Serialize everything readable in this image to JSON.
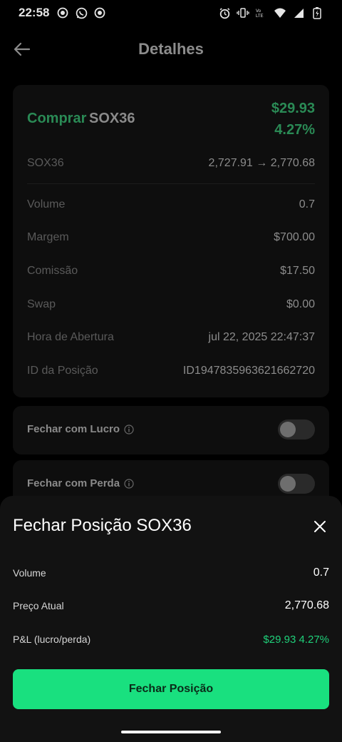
{
  "status_bar": {
    "time": "22:58",
    "left_icons": [
      "record-icon",
      "whatsapp-icon",
      "record-icon"
    ],
    "right_icons": [
      "alarm-icon",
      "vibrate-icon",
      "volte-icon",
      "wifi-icon",
      "signal-icon",
      "battery-icon"
    ]
  },
  "header": {
    "back_icon": "arrow-left-icon",
    "title": "Detalhes"
  },
  "position": {
    "side": "Comprar",
    "symbol": "SOX36",
    "pnl_amount": "$29.93",
    "pnl_percent": "4.27%",
    "rows": [
      {
        "label": "SOX36",
        "value": "2,727.91 → 2,770.68"
      },
      {
        "label": "Volume",
        "value": "0.7"
      },
      {
        "label": "Margem",
        "value": "$700.00"
      },
      {
        "label": "Comissão",
        "value": "$17.50"
      },
      {
        "label": "Swap",
        "value": "$0.00"
      },
      {
        "label": "Hora de Abertura",
        "value": "jul 22, 2025 22:47:37"
      },
      {
        "label": "ID da Posição",
        "value": "ID1947835963621662720"
      }
    ]
  },
  "toggles": [
    {
      "label": "Fechar com Lucro",
      "icon": "info-icon",
      "on": false
    },
    {
      "label": "Fechar com Perda",
      "icon": "info-icon",
      "on": false
    }
  ],
  "close_sheet": {
    "title": "Fechar Posição SOX36",
    "close_icon": "close-icon",
    "rows": [
      {
        "label": "Volume",
        "value": "0.7"
      },
      {
        "label": "Preço Atual",
        "value": "2,770.68"
      },
      {
        "label": "P&L (lucro/perda)",
        "value": "$29.93 4.27%"
      }
    ],
    "button_label": "Fechar Posição"
  },
  "colors": {
    "accent_green": "#19e07f",
    "profit_green": "#1fd07a",
    "background": "#000000",
    "sheet_bg": "#121212"
  }
}
